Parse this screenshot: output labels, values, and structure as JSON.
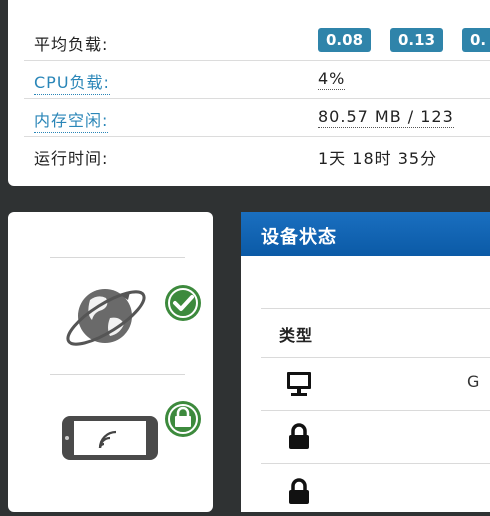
{
  "system_status": {
    "rows": [
      {
        "label": "平均负载:",
        "badges": [
          "0.08",
          "0.13",
          "0."
        ]
      },
      {
        "label": "CPU负载:",
        "value": "4%"
      },
      {
        "label": "内存空闲:",
        "value": "80.57 MB / 123"
      },
      {
        "label": "运行时间:",
        "value": "1天 18时 35分"
      }
    ]
  },
  "sidebar": {
    "items": [
      {
        "icon": "globe-internet-icon",
        "status_icon": "check-circle-icon",
        "status_color": "#3d8a3d"
      },
      {
        "icon": "wireless-device-icon",
        "status_icon": "lock-badge-icon",
        "status_color": "#3d8a3d"
      }
    ]
  },
  "device_status": {
    "title": "设备状态",
    "column_header": "类型",
    "rows": [
      {
        "icon": "monitor-icon",
        "value": "G"
      },
      {
        "icon": "lock-icon",
        "value": ""
      },
      {
        "icon": "lock-icon",
        "value": ""
      }
    ]
  },
  "colors": {
    "badge_bg": "#2f84aa",
    "link": "#2a86b8",
    "header_blue": "#0b5aa6",
    "status_green": "#3d8a3d"
  }
}
